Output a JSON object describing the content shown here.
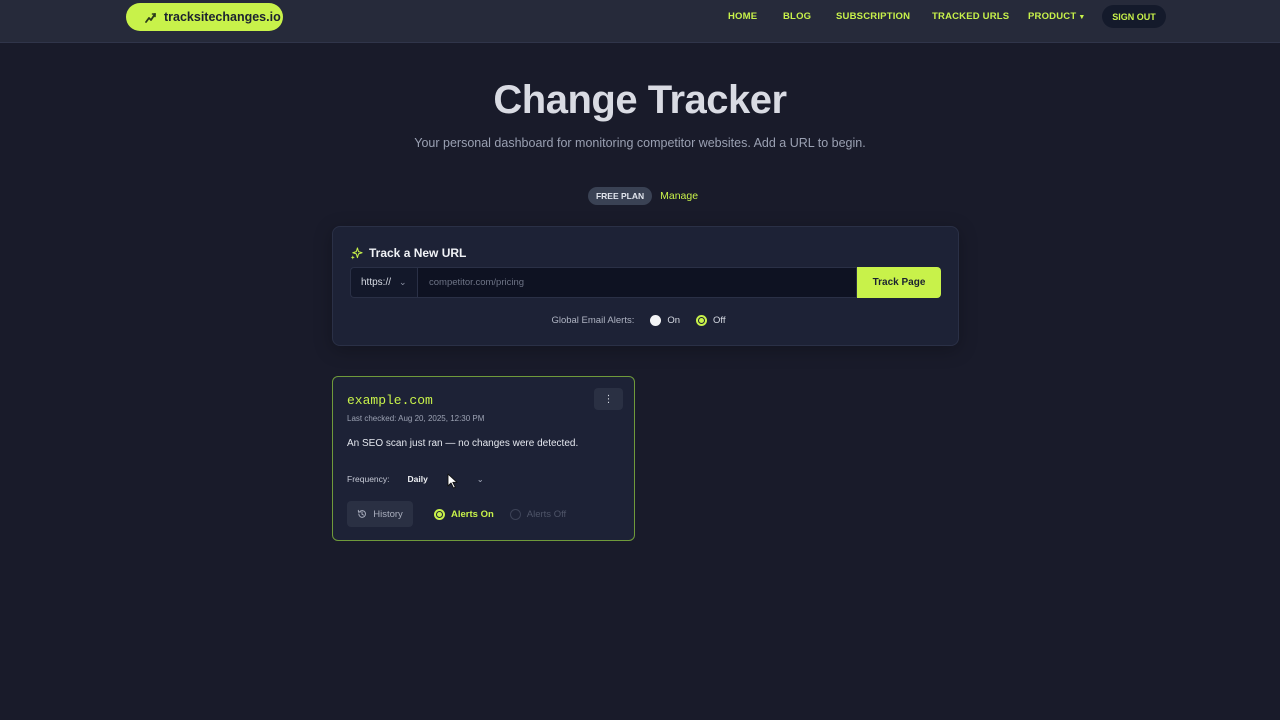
{
  "brand": {
    "name": "tracksitechanges.io",
    "accent": "#c8f24a"
  },
  "nav": {
    "home": "HOME",
    "blog": "BLOG",
    "subscription": "SUBSCRIPTION",
    "tracked_urls": "TRACKED URLS",
    "product": "PRODUCT",
    "sign_out": "SIGN OUT"
  },
  "hero": {
    "title": "Change Tracker",
    "subtitle": "Your personal dashboard for monitoring competitor websites. Add a URL to begin.",
    "plan_badge": "FREE PLAN",
    "manage": "Manage"
  },
  "track": {
    "title": "Track a New URL",
    "protocol": "https://",
    "url_placeholder": "competitor.com/pricing",
    "url_value": "",
    "button": "Track Page",
    "alerts_label": "Global Email Alerts:",
    "alerts_on": "On",
    "alerts_off": "Off",
    "alerts_selected": "Off"
  },
  "site": {
    "domain": "example.com",
    "last_checked": "Last checked: Aug 20, 2025, 12:30 PM",
    "message": "An SEO scan just ran — no changes were detected.",
    "frequency_label": "Frequency:",
    "frequency": "Daily",
    "history": "History",
    "alerts_on": "Alerts On",
    "alerts_off": "Alerts Off",
    "alerts_selected": "Alerts On"
  }
}
